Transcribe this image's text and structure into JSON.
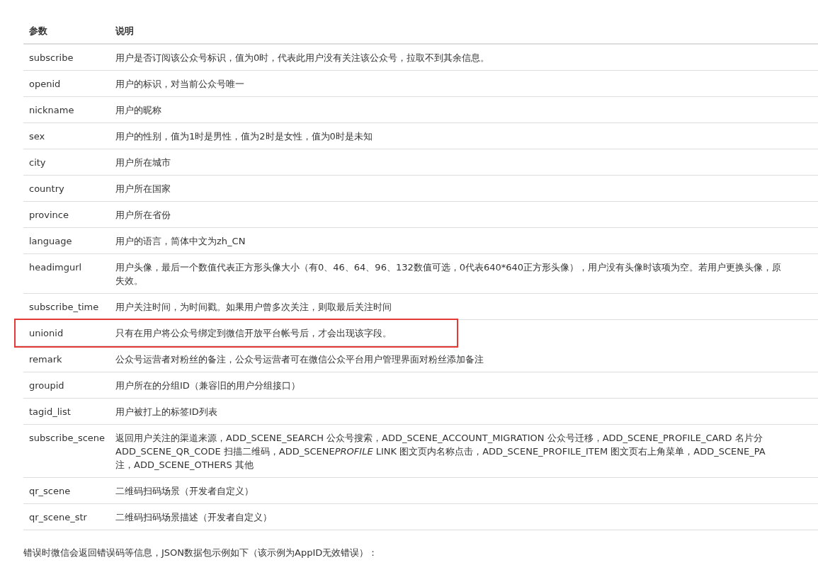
{
  "table": {
    "columns": [
      "参数",
      "说明"
    ],
    "rows": [
      {
        "param": "subscribe",
        "description": [
          "用户是否订阅该公众号标识，值为0时，代表此用户没有关注该公众号，拉取不到其余信息。"
        ],
        "highlighted": false
      },
      {
        "param": "openid",
        "description": [
          "用户的标识，对当前公众号唯一"
        ],
        "highlighted": false
      },
      {
        "param": "nickname",
        "description": [
          "用户的昵称"
        ],
        "highlighted": false
      },
      {
        "param": "sex",
        "description": [
          "用户的性别，值为1时是男性，值为2时是女性，值为0时是未知"
        ],
        "highlighted": false
      },
      {
        "param": "city",
        "description": [
          "用户所在城市"
        ],
        "highlighted": false
      },
      {
        "param": "country",
        "description": [
          "用户所在国家"
        ],
        "highlighted": false
      },
      {
        "param": "province",
        "description": [
          "用户所在省份"
        ],
        "highlighted": false
      },
      {
        "param": "language",
        "description": [
          "用户的语言，简体中文为zh_CN"
        ],
        "highlighted": false
      },
      {
        "param": "headimgurl",
        "description": [
          "用户头像，最后一个数值代表正方形头像大小（有0、46、64、96、132数值可选，0代表640*640正方形头像），用户没有头像时该项为空。若用户更换头像，原",
          "失效。"
        ],
        "highlighted": false
      },
      {
        "param": "subscribe_time",
        "description": [
          "用户关注时间，为时间戳。如果用户曾多次关注，则取最后关注时间"
        ],
        "highlighted": false
      },
      {
        "param": "unionid",
        "description": [
          "只有在用户将公众号绑定到微信开放平台帐号后，才会出现该字段。"
        ],
        "highlighted": true
      },
      {
        "param": "remark",
        "description": [
          "公众号运营者对粉丝的备注，公众号运营者可在微信公众平台用户管理界面对粉丝添加备注"
        ],
        "highlighted": false
      },
      {
        "param": "groupid",
        "description": [
          "用户所在的分组ID（兼容旧的用户分组接口）"
        ],
        "highlighted": false
      },
      {
        "param": "tagid_list",
        "description": [
          "用户被打上的标签ID列表"
        ],
        "highlighted": false
      },
      {
        "param": "subscribe_scene",
        "description": [
          "返回用户关注的渠道来源，ADD_SCENE_SEARCH 公众号搜索，ADD_SCENE_ACCOUNT_MIGRATION 公众号迁移，ADD_SCENE_PROFILE_CARD 名片分",
          [
            {
              "text": "ADD_SCENE_QR_CODE 扫描二维码，ADD_SCENE",
              "italic": false
            },
            {
              "text": "PROFILE",
              "italic": true
            },
            {
              "text": " LINK 图文页内名称点击，ADD_SCENE_PROFILE_ITEM 图文页右上角菜单，ADD_SCENE_PA",
              "italic": false
            }
          ],
          "注，ADD_SCENE_OTHERS 其他"
        ],
        "highlighted": false
      },
      {
        "param": "qr_scene",
        "description": [
          "二维码扫码场景（开发者自定义）"
        ],
        "highlighted": false
      },
      {
        "param": "qr_scene_str",
        "description": [
          "二维码扫码场景描述（开发者自定义）"
        ],
        "highlighted": false
      }
    ]
  },
  "footer_text": "错误时微信会返回错误码等信息，JSON数据包示例如下（该示例为AppID无效错误）："
}
